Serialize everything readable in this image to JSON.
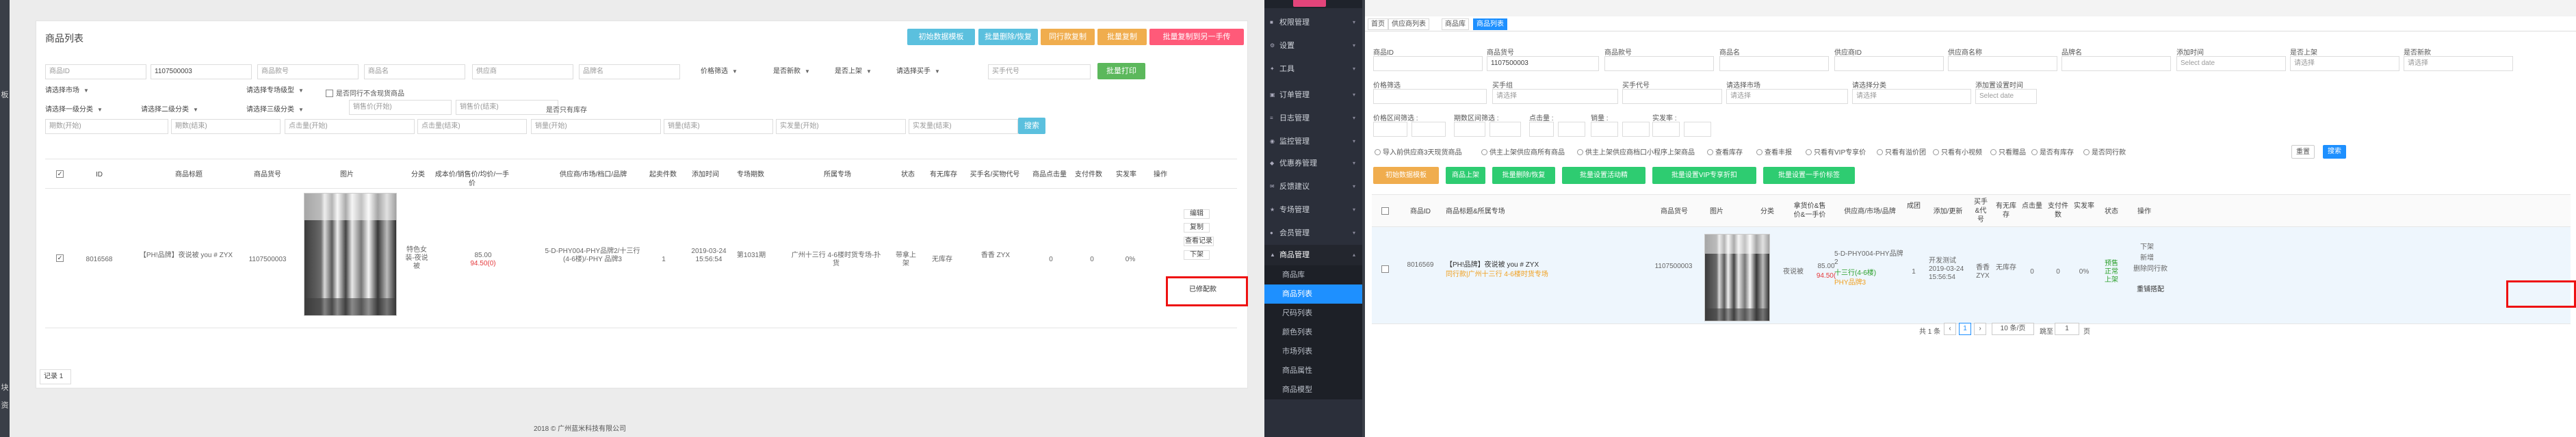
{
  "left": {
    "sidebar_strip": [
      "板",
      "块",
      "资"
    ],
    "title": "商品列表",
    "actions": [
      {
        "label": "初始数据模板",
        "color": "#5bc0de"
      },
      {
        "label": "批量删除/恢复",
        "color": "#5bc0de"
      },
      {
        "label": "同行款复制",
        "color": "#f0ad4e"
      },
      {
        "label": "批量复制",
        "color": "#f0ad4e"
      },
      {
        "label": "批量复制到另一手传",
        "color": "#ff5a79"
      }
    ],
    "filters_row1": [
      {
        "placeholder": "商品ID",
        "value": ""
      },
      {
        "placeholder": "",
        "value": "1107500003"
      },
      {
        "placeholder": "商品款号",
        "value": ""
      },
      {
        "placeholder": "商品名",
        "value": ""
      },
      {
        "placeholder": "供应商",
        "value": ""
      },
      {
        "placeholder": "品牌名",
        "value": ""
      }
    ],
    "selects_row1": [
      "价格筛选",
      "是否新款",
      "是否上架",
      "请选择买手"
    ],
    "buyer_code_placeholder": "买手代号",
    "batch_print": "批量打印",
    "selects_row2": [
      "请选择市场",
      "请选择专场级型"
    ],
    "price_min_placeholder": "销售价(开始)",
    "price_max_placeholder": "销售价(结束)",
    "only_show_label": "是否只有库存",
    "checkbox_no_same": "是否同行不含现货商品",
    "selects_row3": [
      "请选择一级分类",
      "请选择二级分类",
      "请选择三级分类"
    ],
    "stock_min_placeholder": "库存(开始)",
    "filter_row4": [
      "期数(开始)",
      "期数(结束)",
      "点击量(开始)",
      "点击量(结束)",
      "销量(开始)",
      "销量(结束)",
      "实发量(开始)",
      "实发量(结束)"
    ],
    "search_button": "搜索",
    "table_headers": [
      "ID",
      "商品标题",
      "商品货号",
      "图片",
      "分类",
      "成本价/销售价/均价/一手价",
      "供应商/市场/档口/品牌",
      "起卖件数",
      "添加时间",
      "专场期数",
      "所属专场",
      "状态",
      "有无库存",
      "买手名/买物代号",
      "商品点击量",
      "支付件数",
      "实发率",
      "操作"
    ],
    "row": {
      "id": "8016568",
      "title": "【PH!品牌】夜说被 you # ZYX",
      "sku": "1107500003",
      "category": "特色女装-夜说被",
      "cost_price": "85.00",
      "sale_price": "94.50(0)",
      "supplier": "5-D-PHY004-PHY品牌2/十三行(4-6楼)/-PHY 品牌3",
      "min_qty": "1",
      "added": "2019-03-24 15:56:54",
      "period": "第1031期",
      "special": "广州十三行 4-6楼时货专场-扑货",
      "status": "带拿上架",
      "stock": "无库存",
      "buyer": "香香 ZYX",
      "clicks": "0",
      "pay_qty": "0",
      "ship_rate": "0%",
      "ops": [
        "编辑",
        "复制",
        "查看记录",
        "下架"
      ]
    },
    "highlight_button": "已修配款",
    "page_size": "记录 1",
    "footer": "2018 © 广州蓝米科技有限公司"
  },
  "nav": {
    "items": [
      "权限管理",
      "设置",
      "工具",
      "订单管理",
      "日志管理",
      "监控管理",
      "优惠券管理",
      "反馈建议",
      "专场管理",
      "会员管理",
      "商品管理"
    ],
    "sub_items": [
      "商品库",
      "商品列表",
      "尺码列表",
      "颜色列表",
      "市场列表",
      "商品属性",
      "商品模型"
    ],
    "active_sub": "商品列表"
  },
  "right": {
    "tabs": [
      "首页",
      "供应商列表",
      "商品库",
      "商品列表"
    ],
    "labels_row1": [
      "商品ID",
      "商品货号",
      "商品款号",
      "商品名",
      "供应商ID",
      "供应商名称",
      "品牌名",
      "添加时间",
      "是否上架",
      "是否新款"
    ],
    "sku_value": "1107500003",
    "date_placeholder": "Select date",
    "select_placeholder": "请选择",
    "labels_row2": [
      "价格筛选",
      "买手组",
      "买手代号",
      "请选择市场",
      "请选择分类",
      "添加置设置时间"
    ],
    "labels_row3": [
      "价格区间筛选 :",
      "期数区间筛选 :",
      "点击量 :",
      "销量 :",
      "实发率 :"
    ],
    "radios": [
      "导入前供应商3天现货商品",
      "供主上架供应商所有商品",
      "供主上架供应商档口小程序上架商品",
      "查看库存",
      "查看丰报",
      "只看有VIP专享价",
      "只看有溢价团",
      "只看有小视频",
      "只看赠品",
      "是否有库存",
      "是否同行款"
    ],
    "reset_button": "重置",
    "search_button": "搜索",
    "actions": [
      {
        "label": "初始数据模板",
        "color": "#f0ad4e"
      },
      {
        "label": "商品上架",
        "color": "#2ecc71"
      },
      {
        "label": "批量删除/恢复",
        "color": "#2ecc71"
      },
      {
        "label": "批量设置活动精",
        "color": "#2ecc71"
      },
      {
        "label": "批量设置VIP专享折扣",
        "color": "#2ecc71"
      },
      {
        "label": "批量设置一手价标签",
        "color": "#2ecc71"
      }
    ],
    "table_headers": [
      "商品ID",
      "商品标题&所属专场",
      "商品货号",
      "图片",
      "分类",
      "拿货价&售价&一手价",
      "供应商/市场/品牌",
      "成团",
      "添加/更新",
      "买手&代号",
      "有无库存",
      "点击量",
      "支付件数",
      "实发率",
      "状态",
      "操作"
    ],
    "row": {
      "id": "8016569",
      "title": "【PH!品牌】夜说被 you # ZYX",
      "subtitle": "同行款|广州十三行 4-6楼时货专场",
      "sku": "1107500003",
      "category": "夜说被",
      "price1": "85.00",
      "price2": "94.50(",
      "supplier": "5-D-PHY004-PHY品牌2",
      "market": "十三行(4-6楼)",
      "brand": "PHY品牌3",
      "group": "1",
      "added": "开发测试 2019-03-24 15:56:54",
      "buyer": "香香 ZYX",
      "stock": "无库存",
      "clicks": "0",
      "pay_qty": "0",
      "ship_rate": "0%",
      "status": "预售 正常 上架",
      "ops": [
        "下架",
        "新增",
        "删除同行款"
      ]
    },
    "highlight_button": "重铺搭配",
    "pager": {
      "total": "共 1 条",
      "page": "1",
      "per_page": "10 条/页",
      "goto_label": "跳至",
      "goto_value": "1",
      "page_suffix": "页"
    }
  },
  "colors": {
    "sidebar": "#2b2f3a",
    "active": "#1e90ff",
    "highlight": "#ee1111"
  }
}
